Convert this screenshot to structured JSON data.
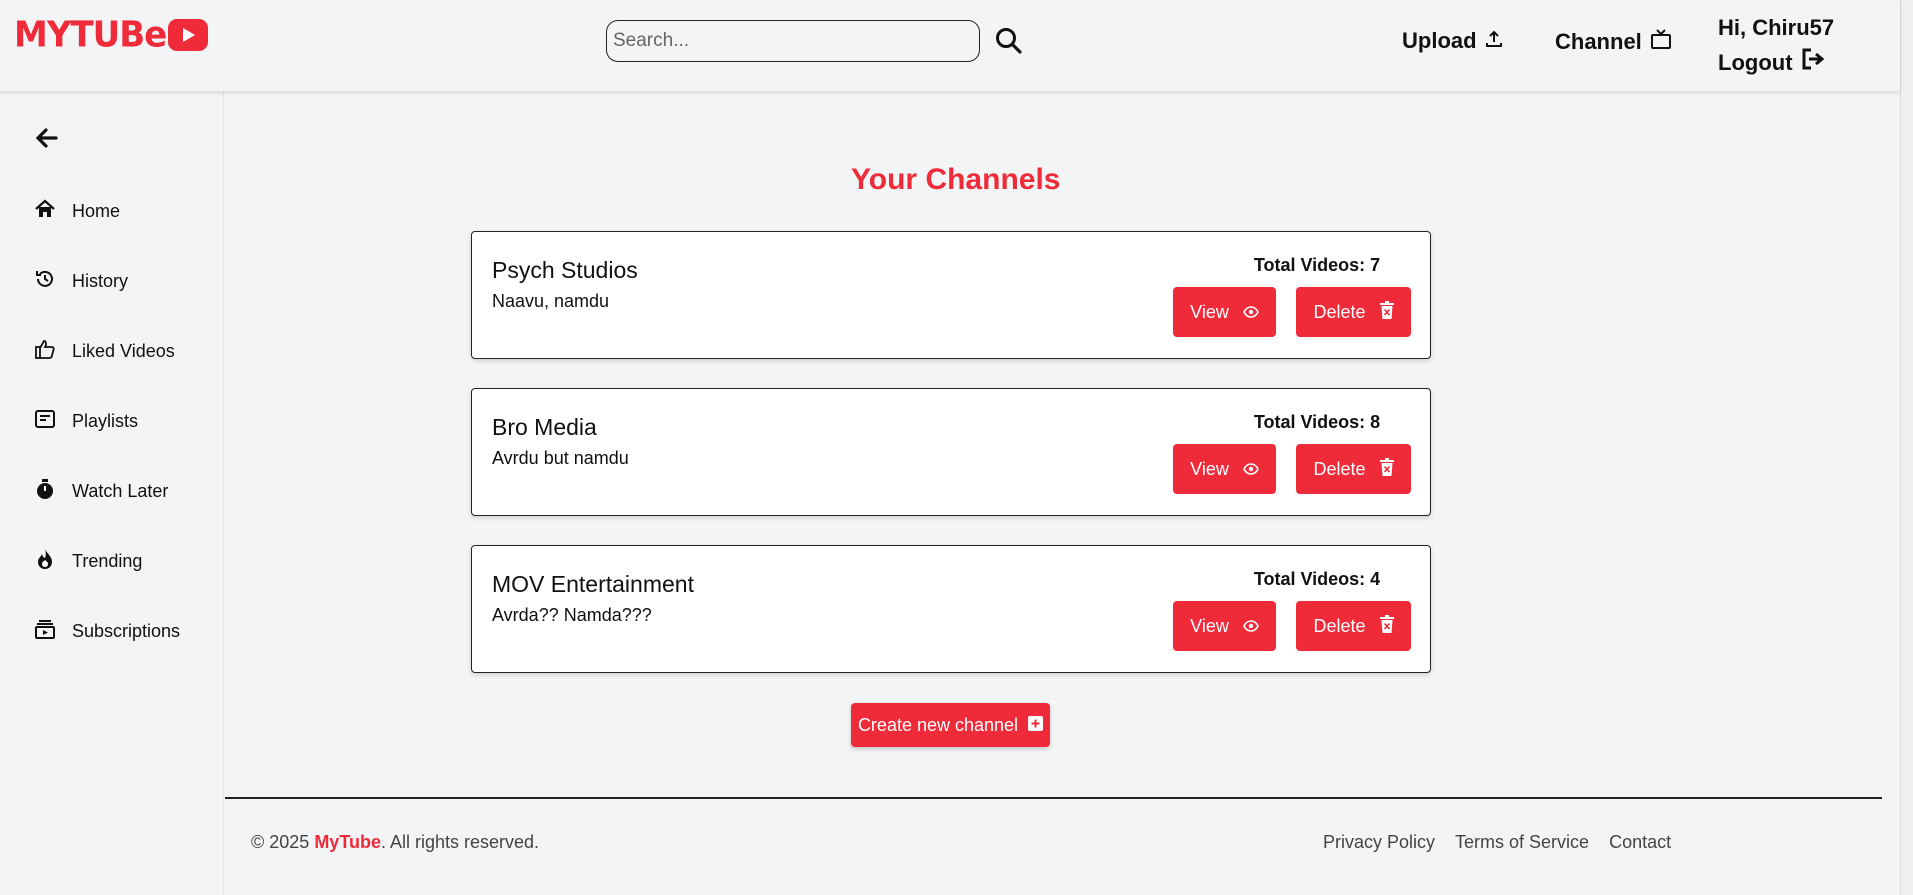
{
  "header": {
    "logo_text": "MYTUBe",
    "search_placeholder": "Search...",
    "upload_label": "Upload",
    "channel_label": "Channel",
    "greeting": "Hi, Chiru57",
    "logout_label": "Logout"
  },
  "sidebar": {
    "items": [
      {
        "label": "Home",
        "icon": "home-icon"
      },
      {
        "label": "History",
        "icon": "history-icon"
      },
      {
        "label": "Liked Videos",
        "icon": "thumbs-up-icon"
      },
      {
        "label": "Playlists",
        "icon": "playlist-icon"
      },
      {
        "label": "Watch Later",
        "icon": "stopwatch-icon"
      },
      {
        "label": "Trending",
        "icon": "flame-icon"
      },
      {
        "label": "Subscriptions",
        "icon": "subscriptions-icon"
      }
    ]
  },
  "main": {
    "title": "Your Channels",
    "channels": [
      {
        "name": "Psych Studios",
        "description": "Naavu, namdu",
        "total_videos": "Total Videos: 7"
      },
      {
        "name": "Bro Media",
        "description": "Avrdu but namdu",
        "total_videos": "Total Videos: 8"
      },
      {
        "name": "MOV Entertainment",
        "description": "Avrda?? Namda???",
        "total_videos": "Total Videos: 4"
      }
    ],
    "view_label": "View",
    "delete_label": "Delete",
    "create_label": "Create new channel"
  },
  "footer": {
    "copyright_prefix": "© 2025 ",
    "brand": "MyTube",
    "copyright_suffix": ". All rights reserved.",
    "links": [
      "Privacy Policy",
      "Terms of Service",
      "Contact"
    ]
  },
  "colors": {
    "accent": "#ef2b3a",
    "background": "#f3f4f6"
  }
}
